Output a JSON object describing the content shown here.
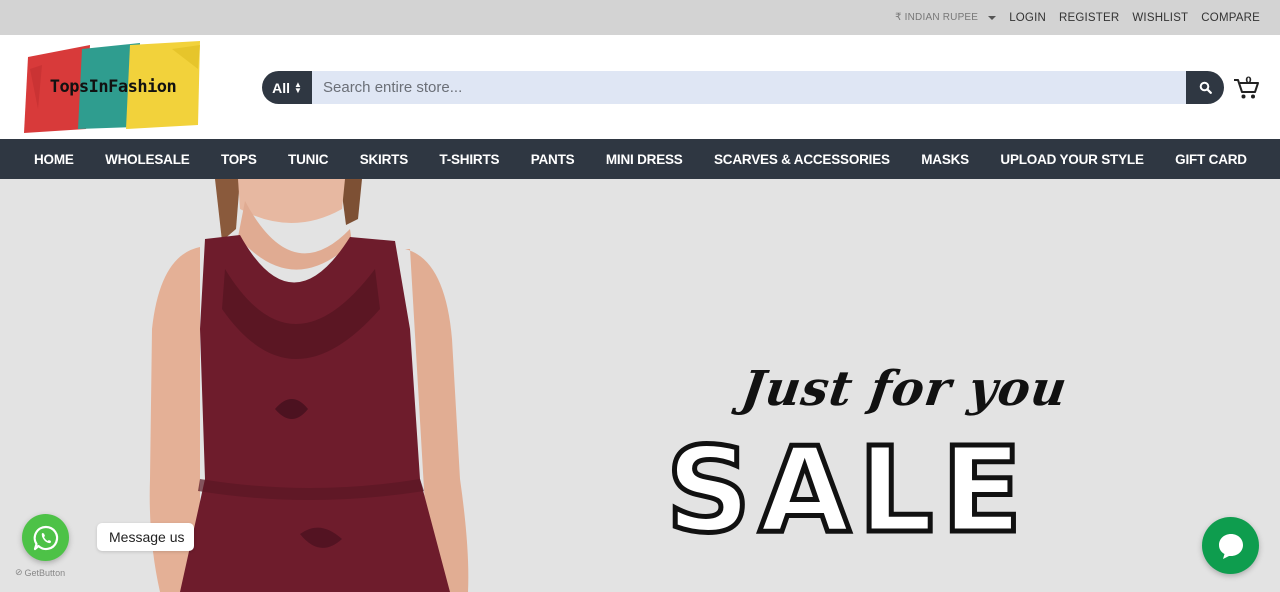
{
  "topbar": {
    "currency": "₹ INDIAN RUPEE",
    "links": [
      "LOGIN",
      "REGISTER",
      "WISHLIST",
      "COMPARE"
    ]
  },
  "logo": {
    "text": "TopsInFashion"
  },
  "search": {
    "category": "All",
    "placeholder": "Search entire store..."
  },
  "nav": {
    "items": [
      "HOME",
      "WHOLESALE",
      "TOPS",
      "TUNIC",
      "SKIRTS",
      "T-SHIRTS",
      "PANTS",
      "MINI DRESS",
      "SCARVES & ACCESSORIES",
      "MASKS",
      "UPLOAD YOUR STYLE",
      "GIFT CARD"
    ]
  },
  "hero": {
    "script_text": "Just for you",
    "headline": "SALE"
  },
  "widgets": {
    "whatsapp_label": "Message us",
    "powered_by": "GetButton"
  },
  "colors": {
    "topbar_bg": "#d3d3d3",
    "nav_bg": "#2f3742",
    "search_bg": "#dfe6f4",
    "whatsapp_green": "#4dc247",
    "chat_green": "#0e9d4e",
    "dress": "#6e1c2c"
  },
  "icons": [
    "caret-down-icon",
    "search-icon",
    "cart-icon",
    "whatsapp-icon",
    "chat-bubble-icon"
  ]
}
